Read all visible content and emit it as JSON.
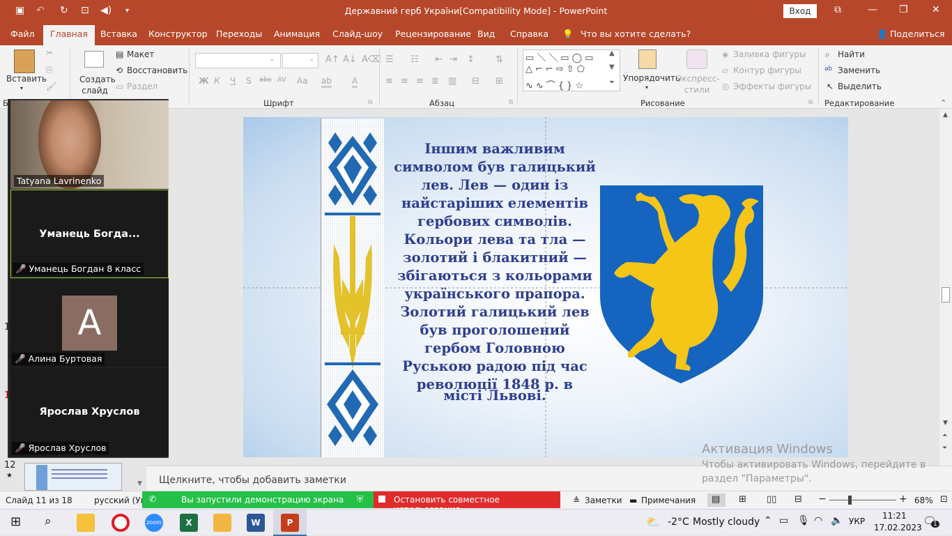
{
  "titlebar": {
    "title": "Державний герб України[Compatibility Mode]  -  PowerPoint",
    "signin": "Вход"
  },
  "tabs": [
    "Файл",
    "Главная",
    "Вставка",
    "Конструктор",
    "Переходы",
    "Анимация",
    "Слайд-шоу",
    "Рецензирование",
    "Вид",
    "Справка",
    "Что вы хотите сделать?",
    "Поделиться"
  ],
  "ribbon": {
    "paste": "Вставить",
    "new_slide": "Создать слайд",
    "layout": "Макет",
    "reset": "Восстановить",
    "section": "Раздел",
    "slides_group": "Бу",
    "font_group": "Шрифт",
    "paragraph_group": "Абзац",
    "drawing_group": "Рисование",
    "editing_group": "Редактирование",
    "arrange": "Упорядочить",
    "quick_styles": "Экспресс-стили",
    "shape_fill": "Заливка фигуры",
    "shape_outline": "Контур фигуры",
    "shape_effects": "Эффекты фигуры",
    "find": "Найти",
    "replace": "Заменить",
    "select": "Выделить",
    "bold": "Ж",
    "italic": "К",
    "underline": "Ч",
    "shadow": "S",
    "strike": "abc",
    "spacing": "AV",
    "case": "Aa",
    "font_color": "A"
  },
  "slide": {
    "text_main": "Іншим важливим символом був галицький лев. Лев — один із найстаріших елементів гербових символів. Кольори лева та тла — золотий і блакитний — збігаються з кольорами українського прапора. Золотий галицький лев був проголошений гербом Головною Руською радою під час революції 1848 р. в",
    "text_end": "місті Львові."
  },
  "thumbs": {
    "n1": "1",
    "n2": "1",
    "n12": "12",
    "star": "★"
  },
  "notes_placeholder": "Щелкните, чтобы добавить заметки",
  "activation": {
    "line1": "Активация Windows",
    "line2": "Чтобы активировать Windows, перейдите в раздел \"Параметры\"."
  },
  "statusbar": {
    "slide_counter": "Слайд 11 из 18",
    "language": "русский (Укр",
    "share_msg": "Вы запустили демонстрацию экрана",
    "stop_share": "Остановить совместное использование",
    "notes": "Заметки",
    "comments": "Примечания",
    "zoom": "68%"
  },
  "zoom_gallery": {
    "tiles": [
      {
        "name": "Tatyana Lavrinenko",
        "center": ""
      },
      {
        "name": "Уманець Богдан 8 класс",
        "center": "Уманець  Богда..."
      },
      {
        "name": "Алина Буртовая",
        "center": "",
        "avatar_letter": "A"
      },
      {
        "name": "Ярослав Хруслов",
        "center": "Ярослав Хруслов"
      }
    ]
  },
  "taskbar": {
    "weather_temp": "-2°C",
    "weather_desc": "Mostly cloudy",
    "lang": "УКР",
    "time": "11:21",
    "date": "17.02.2023",
    "notif_count": "1"
  },
  "colors": {
    "ppt_accent": "#b7472a",
    "slide_text": "#2e3f8f",
    "shield_blue": "#1564c0",
    "lion_gold": "#f5c518",
    "share_green": "#25c048",
    "stop_red": "#e02b2b"
  }
}
